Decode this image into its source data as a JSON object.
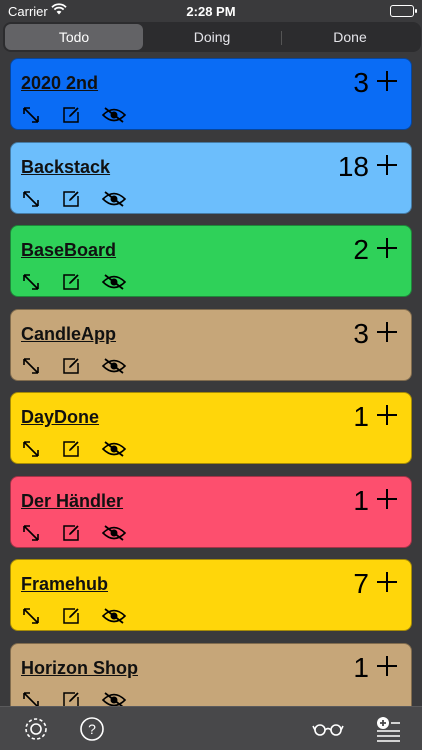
{
  "status": {
    "carrier": "Carrier",
    "time": "2:28 PM"
  },
  "tabs": [
    {
      "label": "Todo",
      "active": true
    },
    {
      "label": "Doing",
      "active": false
    },
    {
      "label": "Done",
      "active": false
    }
  ],
  "cards": [
    {
      "title": "2020 2nd",
      "count": "3",
      "color": "#0a6cf5"
    },
    {
      "title": "Backstack",
      "count": "18",
      "color": "#6cbefc"
    },
    {
      "title": "BaseBoard",
      "count": "2",
      "color": "#2fd159"
    },
    {
      "title": "CandleApp",
      "count": "3",
      "color": "#c6a679"
    },
    {
      "title": "DayDone",
      "count": "1",
      "color": "#ffd60a"
    },
    {
      "title": "Der Händler",
      "count": "1",
      "color": "#fd4f6e"
    },
    {
      "title": "Framehub",
      "count": "7",
      "color": "#ffd60a"
    },
    {
      "title": "Horizon Shop",
      "count": "1",
      "color": "#c6a679"
    }
  ],
  "toolbar": {
    "settings_icon": "gear-icon",
    "help_icon": "question-icon",
    "glasses_icon": "glasses-icon",
    "add_list_icon": "add-list-icon"
  }
}
